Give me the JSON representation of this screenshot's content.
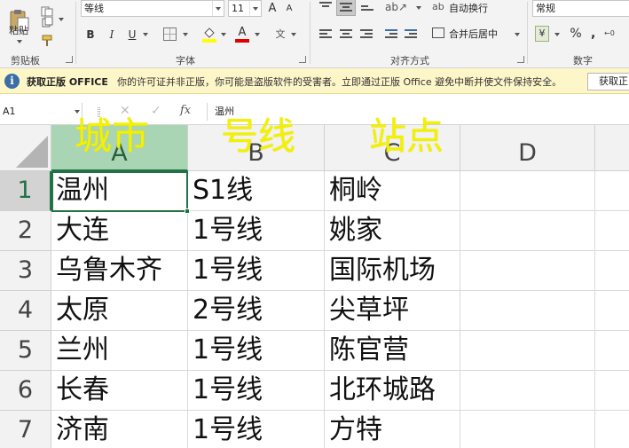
{
  "ribbon": {
    "clipboard": {
      "paste_label": "粘贴",
      "group_label": "剪贴板"
    },
    "font": {
      "font_name": "等线",
      "font_size": "11",
      "grow_label": "A",
      "shrink_label": "A",
      "bold": "B",
      "italic": "I",
      "underline": "U",
      "group_label": "字体"
    },
    "alignment": {
      "wrap_label": "自动换行",
      "merge_label": "合并后居中",
      "group_label": "对齐方式"
    },
    "number": {
      "format": "常规",
      "percent": "%",
      "group_label": "数字"
    }
  },
  "message_bar": {
    "title": "获取正版 OFFICE",
    "text": "你的许可证并非正版，你可能是盗版软件的受害者。立即通过正版 Office 避免中断并使文件保持安全。",
    "button": "获取正"
  },
  "formula_bar": {
    "name_box": "A1",
    "cancel": "✕",
    "enter": "✓",
    "fx": "fx",
    "content": "温州"
  },
  "columns": [
    "A",
    "B",
    "C",
    "D"
  ],
  "rows": [
    {
      "num": "1",
      "a": "温州",
      "b": "S1线",
      "c": "桐岭"
    },
    {
      "num": "2",
      "a": "大连",
      "b": "1号线",
      "c": "姚家"
    },
    {
      "num": "3",
      "a": "乌鲁木齐",
      "b": "1号线",
      "c": "国际机场"
    },
    {
      "num": "4",
      "a": "太原",
      "b": "2号线",
      "c": "尖草坪"
    },
    {
      "num": "5",
      "a": "兰州",
      "b": "1号线",
      "c": "陈官营"
    },
    {
      "num": "6",
      "a": "长春",
      "b": "1号线",
      "c": "北环城路"
    },
    {
      "num": "7",
      "a": "济南",
      "b": "1号线",
      "c": "方特"
    }
  ],
  "annotations": {
    "col_a": "城市",
    "col_b": "号线",
    "col_c": "站点"
  },
  "colors": {
    "accent_green": "#217346",
    "annotation_yellow": "#f3f100",
    "message_bar": "#fdf6c8"
  }
}
